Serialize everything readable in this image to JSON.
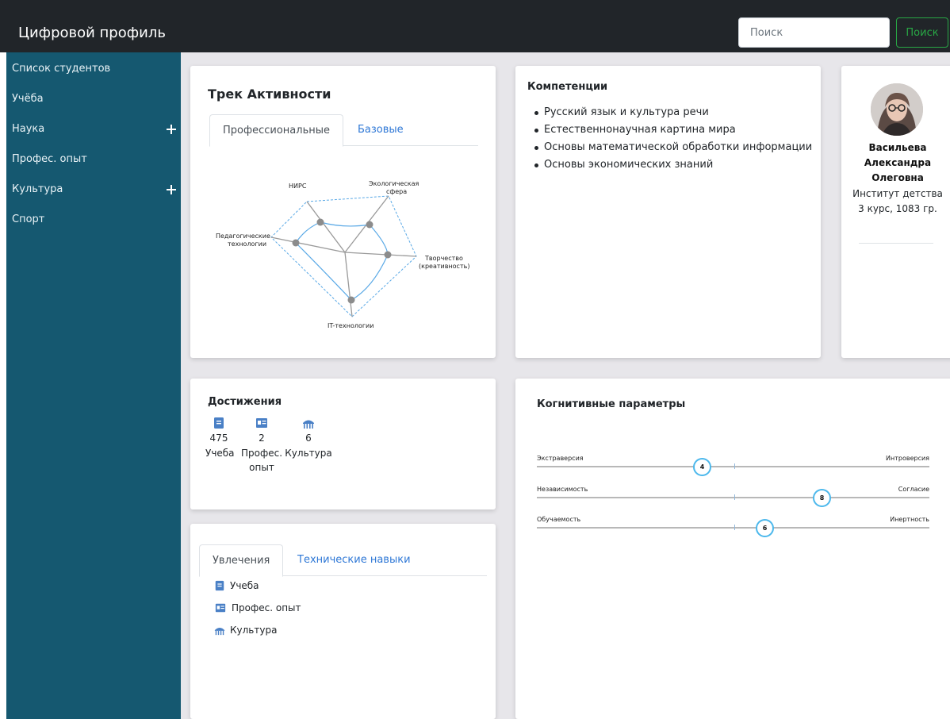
{
  "header": {
    "brand": "Цифровой профиль",
    "search_placeholder": "Поиск",
    "search_button": "Поиск"
  },
  "sidebar": {
    "items": [
      {
        "label": "Список студентов",
        "expandable": false
      },
      {
        "label": "Учёба",
        "expandable": false
      },
      {
        "label": "Наука",
        "expandable": true
      },
      {
        "label": "Профес. опыт",
        "expandable": false
      },
      {
        "label": "Культура",
        "expandable": true
      },
      {
        "label": "Спорт",
        "expandable": false
      }
    ]
  },
  "activity": {
    "title": "Трек Активности",
    "tabs": [
      "Профессиональные",
      "Базовые"
    ],
    "active_tab": "Профессиональные",
    "radar": {
      "axes": [
        "НИРС",
        "Экологическая сфера",
        "Творчество (креативность)",
        "IT-технологии",
        "Педагогические технологии"
      ],
      "axis_label_lines": [
        [
          "НИРС"
        ],
        [
          "Экологическая",
          "сфера"
        ],
        [
          "Творчество",
          "(креативность)"
        ],
        [
          "IT-технологии"
        ],
        [
          "Педагогические",
          "технологии"
        ]
      ]
    }
  },
  "competences": {
    "title": "Компетенции",
    "items": [
      "Русский язык и культура речи",
      "Естественнонаучная картина мира",
      "Основы математической обработки информации",
      "Основы экономических знаний"
    ]
  },
  "profile": {
    "name": "Васильева Александра Олеговна",
    "institute": "Институт детства",
    "course": "3 курс, 1083 гр."
  },
  "achievements": {
    "title": "Достижения",
    "items": [
      {
        "icon": "book-icon",
        "value": "475",
        "label": "Учеба"
      },
      {
        "icon": "id-card-icon",
        "value": "2",
        "label": "Профес. опыт"
      },
      {
        "icon": "theater-icon",
        "value": "6",
        "label": "Культура"
      }
    ]
  },
  "hobbies": {
    "tabs": [
      "Увлечения",
      "Технические навыки"
    ],
    "active_tab": "Увлечения",
    "items": [
      {
        "icon": "book-icon",
        "label": "Учеба"
      },
      {
        "icon": "id-card-icon",
        "label": "Профес. опыт"
      },
      {
        "icon": "theater-icon",
        "label": "Культура"
      }
    ]
  },
  "cognitive": {
    "title": "Когнитивные параметры",
    "params": [
      {
        "left": "Экстраверсия",
        "right": "Интроверсия",
        "value": "4"
      },
      {
        "left": "Независимость",
        "right": "Согласие",
        "value": "8"
      },
      {
        "left": "Обучаемость",
        "right": "Инертность",
        "value": "6"
      }
    ]
  },
  "colors": {
    "topbar": "#212529",
    "sidebar": "#155870",
    "main_bg": "#e7e6ea",
    "link": "#2f78d6",
    "search_button": "#28a745",
    "radar_line": "#5aa9e6",
    "icon": "#4a80c6"
  }
}
